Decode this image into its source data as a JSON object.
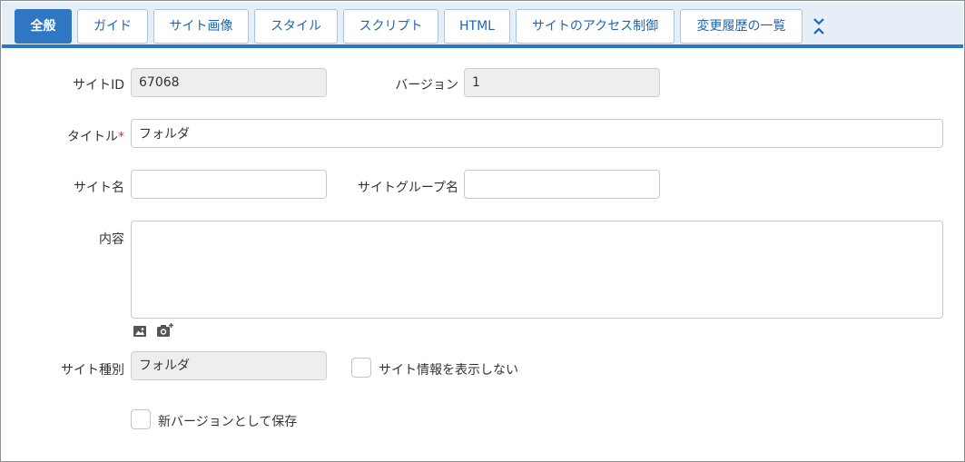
{
  "tabs": [
    {
      "label": "全般",
      "active": true
    },
    {
      "label": "ガイド"
    },
    {
      "label": "サイト画像"
    },
    {
      "label": "スタイル"
    },
    {
      "label": "スクリプト"
    },
    {
      "label": "HTML"
    },
    {
      "label": "サイトのアクセス制御"
    },
    {
      "label": "変更履歴の一覧"
    }
  ],
  "more_icon": "double-chevron-icon",
  "fields": {
    "site_id": {
      "label": "サイトID",
      "value": "67068"
    },
    "version": {
      "label": "バージョン",
      "value": "1"
    },
    "title": {
      "label": "タイトル",
      "required_mark": "*",
      "value": "フォルダ"
    },
    "site_name": {
      "label": "サイト名",
      "value": ""
    },
    "site_group_name": {
      "label": "サイトグループ名",
      "value": ""
    },
    "content": {
      "label": "内容",
      "value": ""
    },
    "site_type": {
      "label": "サイト種別",
      "value": "フォルダ"
    }
  },
  "content_tools": {
    "image_icon": "image-icon",
    "camera_icon": "camera-plus-icon"
  },
  "checkboxes": {
    "hide_site_info": {
      "label": "サイト情報を表示しない",
      "checked": false
    },
    "save_as_new_version": {
      "label": "新バージョンとして保存",
      "checked": false
    }
  },
  "colors": {
    "accent": "#2f77c3",
    "tabbar_bg": "#e6eef7",
    "required": "#e03030",
    "readonly_bg": "#eeeeee"
  }
}
